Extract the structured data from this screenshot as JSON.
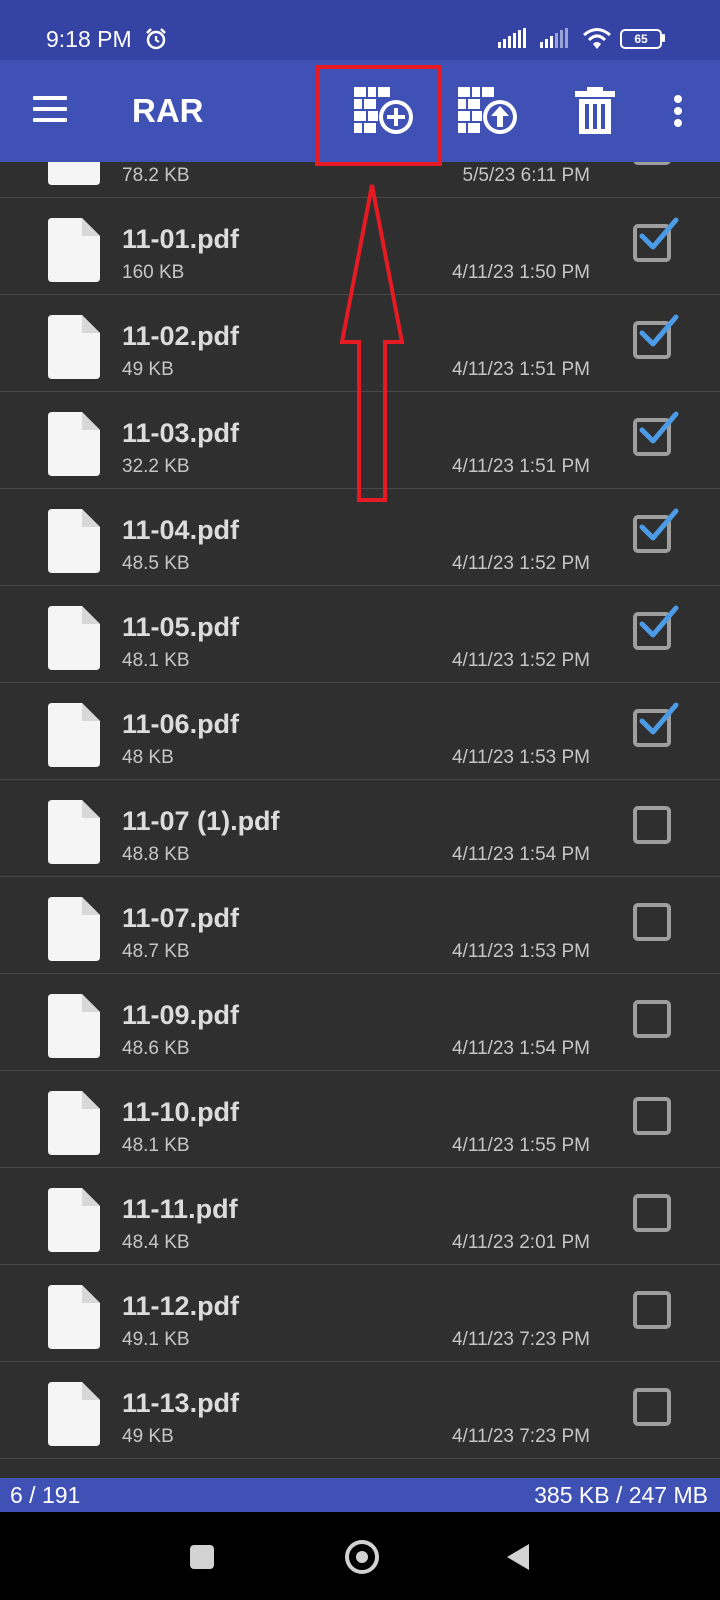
{
  "status_bar": {
    "time": "9:18 PM",
    "battery": "65"
  },
  "app_bar": {
    "title": "RAR",
    "icons": [
      "menu-icon",
      "add-to-archive-icon",
      "extract-icon",
      "trash-icon",
      "more-vert-icon"
    ]
  },
  "files": [
    {
      "name": "",
      "size": "78.2 KB",
      "date": "5/5/23 6:11 PM",
      "checked": false
    },
    {
      "name": "11-01.pdf",
      "size": "160 KB",
      "date": "4/11/23 1:50 PM",
      "checked": true
    },
    {
      "name": "11-02.pdf",
      "size": "49 KB",
      "date": "4/11/23 1:51 PM",
      "checked": true
    },
    {
      "name": "11-03.pdf",
      "size": "32.2 KB",
      "date": "4/11/23 1:51 PM",
      "checked": true
    },
    {
      "name": "11-04.pdf",
      "size": "48.5 KB",
      "date": "4/11/23 1:52 PM",
      "checked": true
    },
    {
      "name": "11-05.pdf",
      "size": "48.1 KB",
      "date": "4/11/23 1:52 PM",
      "checked": true
    },
    {
      "name": "11-06.pdf",
      "size": "48 KB",
      "date": "4/11/23 1:53 PM",
      "checked": true
    },
    {
      "name": "11-07 (1).pdf",
      "size": "48.8 KB",
      "date": "4/11/23 1:54 PM",
      "checked": false
    },
    {
      "name": "11-07.pdf",
      "size": "48.7 KB",
      "date": "4/11/23 1:53 PM",
      "checked": false
    },
    {
      "name": "11-09.pdf",
      "size": "48.6 KB",
      "date": "4/11/23 1:54 PM",
      "checked": false
    },
    {
      "name": "11-10.pdf",
      "size": "48.1 KB",
      "date": "4/11/23 1:55 PM",
      "checked": false
    },
    {
      "name": "11-11.pdf",
      "size": "48.4 KB",
      "date": "4/11/23 2:01 PM",
      "checked": false
    },
    {
      "name": "11-12.pdf",
      "size": "49.1 KB",
      "date": "4/11/23 7:23 PM",
      "checked": false
    },
    {
      "name": "11-13.pdf",
      "size": "49 KB",
      "date": "4/11/23 7:23 PM",
      "checked": false
    }
  ],
  "footer": {
    "selected": "6 / 191",
    "size_summary": "385 KB / 247 MB"
  },
  "colors": {
    "app_bar": "#3f51b5",
    "status_bar": "#3543a4",
    "list_bg": "#2f2f2f",
    "check": "#4b9be6",
    "annotation": "#e51a22"
  }
}
